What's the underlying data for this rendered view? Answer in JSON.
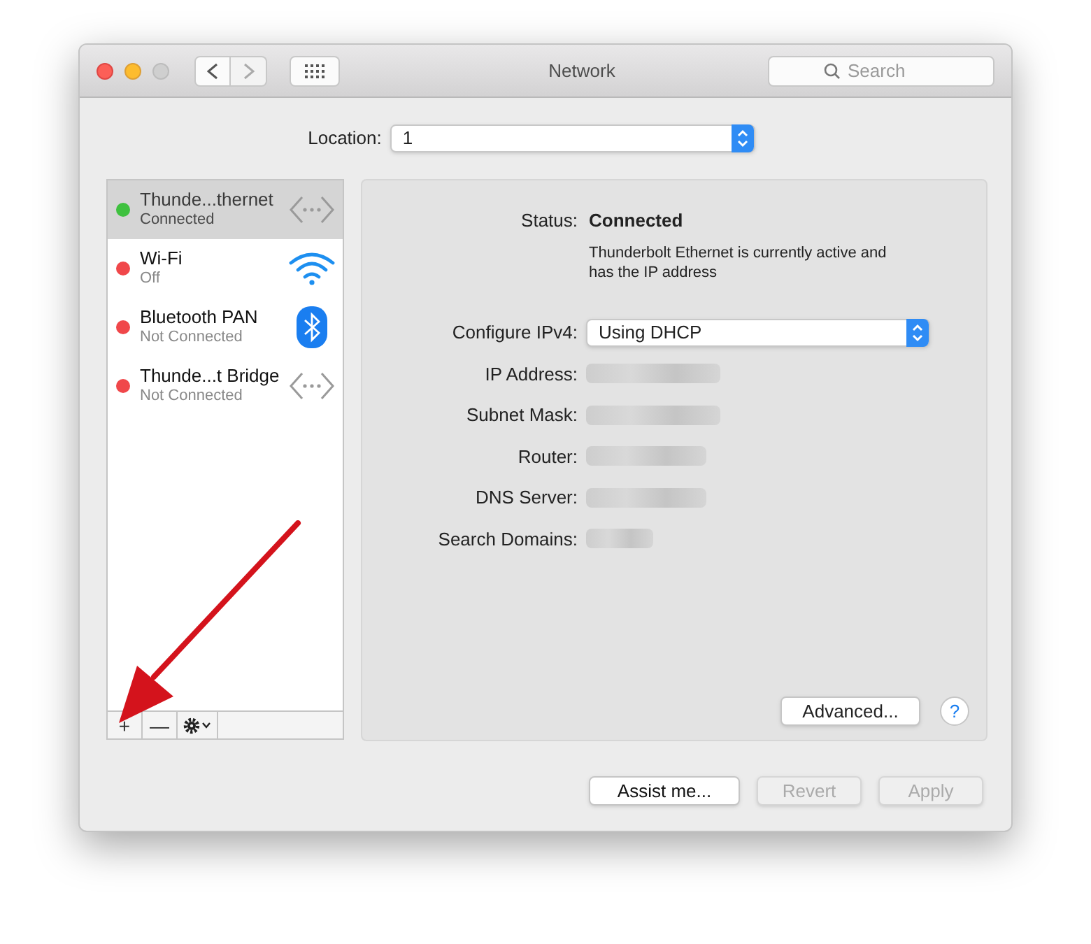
{
  "window": {
    "title": "Network",
    "search_placeholder": "Search"
  },
  "location": {
    "label": "Location:",
    "value": "1"
  },
  "services": [
    {
      "name": "Thunde...thernet",
      "status": "Connected",
      "color": "#3fc13f",
      "selected": true,
      "kind": "ethernet"
    },
    {
      "name": "Wi-Fi",
      "status": "Off",
      "color": "#f0474a",
      "selected": false,
      "kind": "wifi"
    },
    {
      "name": "Bluetooth PAN",
      "status": "Not Connected",
      "color": "#f0474a",
      "selected": false,
      "kind": "bluetooth"
    },
    {
      "name": "Thunde...t Bridge",
      "status": "Not Connected",
      "color": "#f0474a",
      "selected": false,
      "kind": "ethernet"
    }
  ],
  "list_toolbar": [
    "+",
    "—"
  ],
  "detail": {
    "status_label": "Status:",
    "status_value": "Connected",
    "status_note": "Thunderbolt Ethernet is currently active and has the IP address",
    "configure_label": "Configure IPv4:",
    "configure_value": "Using DHCP",
    "fields": [
      {
        "label": "IP Address:"
      },
      {
        "label": "Subnet Mask:"
      },
      {
        "label": "Router:"
      },
      {
        "label": "DNS Server:"
      },
      {
        "label": "Search Domains:"
      }
    ],
    "advanced": "Advanced...",
    "help": "?"
  },
  "buttons": [
    {
      "label": "Assist me...",
      "disabled": false
    },
    {
      "label": "Revert",
      "disabled": true
    },
    {
      "label": "Apply",
      "disabled": true
    }
  ]
}
